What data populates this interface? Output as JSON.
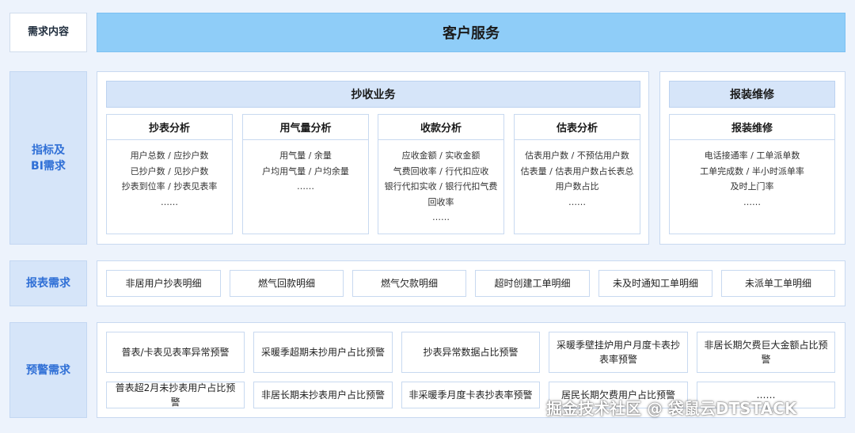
{
  "labels": {
    "requirement": "需求内容",
    "bi": "指标及\nBI需求",
    "report": "报表需求",
    "alert": "预警需求"
  },
  "banner": "客户服务",
  "groups": {
    "meter": "抄收业务",
    "repair": "报装维修"
  },
  "cards": [
    {
      "title": "抄表分析",
      "lines": [
        "用户总数 / 应抄户数",
        "已抄户数 / 见抄户数",
        "抄表到位率 / 抄表见表率",
        "……"
      ]
    },
    {
      "title": "用气量分析",
      "lines": [
        "用气量 / 余量",
        "户均用气量 / 户均余量",
        "……"
      ]
    },
    {
      "title": "收款分析",
      "lines": [
        "应收金额 / 实收金额",
        "气费回收率 / 行代扣应收",
        "银行代扣实收 / 银行代扣气费",
        "回收率",
        "……"
      ]
    },
    {
      "title": "估表分析",
      "lines": [
        "估表用户数 / 不预估用户数",
        "估表量 / 估表用户数占长表总",
        "用户数占比",
        "……"
      ]
    },
    {
      "title": "报装维修",
      "lines": [
        "电话接通率 / 工单派单数",
        "工单完成数 / 半小时派单率",
        "及时上门率",
        "……"
      ]
    }
  ],
  "reports": [
    "非居用户抄表明细",
    "燃气回款明细",
    "燃气欠款明细",
    "超时创建工单明细",
    "未及时通知工单明细",
    "未派单工单明细"
  ],
  "alerts": [
    "普表/卡表见表率异常预警",
    "采暖季超期未抄用户占比预警",
    "抄表异常数据占比预警",
    "采暖季壁挂炉用户月度卡表抄表率预警",
    "非居长期欠费巨大金额占比预警",
    "普表超2月未抄表用户占比预警",
    "非居长期未抄表用户占比预警",
    "非采暖季月度卡表抄表率预警",
    "居民长期欠费用户占比预警",
    "……"
  ],
  "watermark": "掘金技术社区 @ 袋鼠云DTSTACK"
}
